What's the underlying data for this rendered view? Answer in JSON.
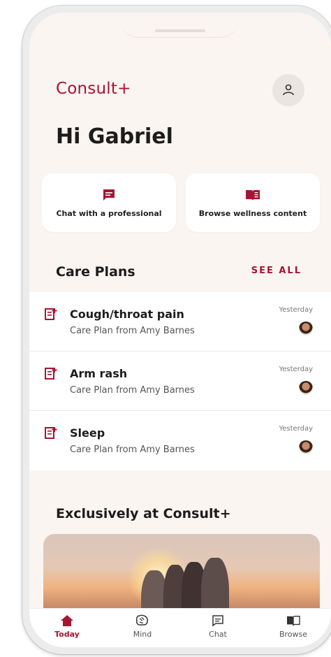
{
  "app": {
    "brand": "Consult+",
    "greeting": "Hi Gabriel"
  },
  "actions": [
    {
      "label": "Chat with a professional",
      "icon": "chat-bubble-icon"
    },
    {
      "label": "Browse wellness content",
      "icon": "book-icon"
    }
  ],
  "care_plans": {
    "title": "Care Plans",
    "see_all": "SEE ALL",
    "items": [
      {
        "title": "Cough/throat pain",
        "subtitle": "Care Plan from Amy Barnes",
        "time": "Yesterday"
      },
      {
        "title": "Arm rash",
        "subtitle": "Care Plan from Amy Barnes",
        "time": "Yesterday"
      },
      {
        "title": "Sleep",
        "subtitle": "Care Plan from Amy Barnes",
        "time": "Yesterday"
      }
    ]
  },
  "exclusive": {
    "title": "Exclusively at Consult+"
  },
  "tabs": [
    {
      "label": "Today",
      "icon": "home-icon",
      "active": true
    },
    {
      "label": "Mind",
      "icon": "brain-icon",
      "active": false
    },
    {
      "label": "Chat",
      "icon": "chat-icon",
      "active": false
    },
    {
      "label": "Browse",
      "icon": "book-icon",
      "active": false
    }
  ],
  "colors": {
    "accent": "#a81432",
    "background": "#fbf5f1"
  }
}
